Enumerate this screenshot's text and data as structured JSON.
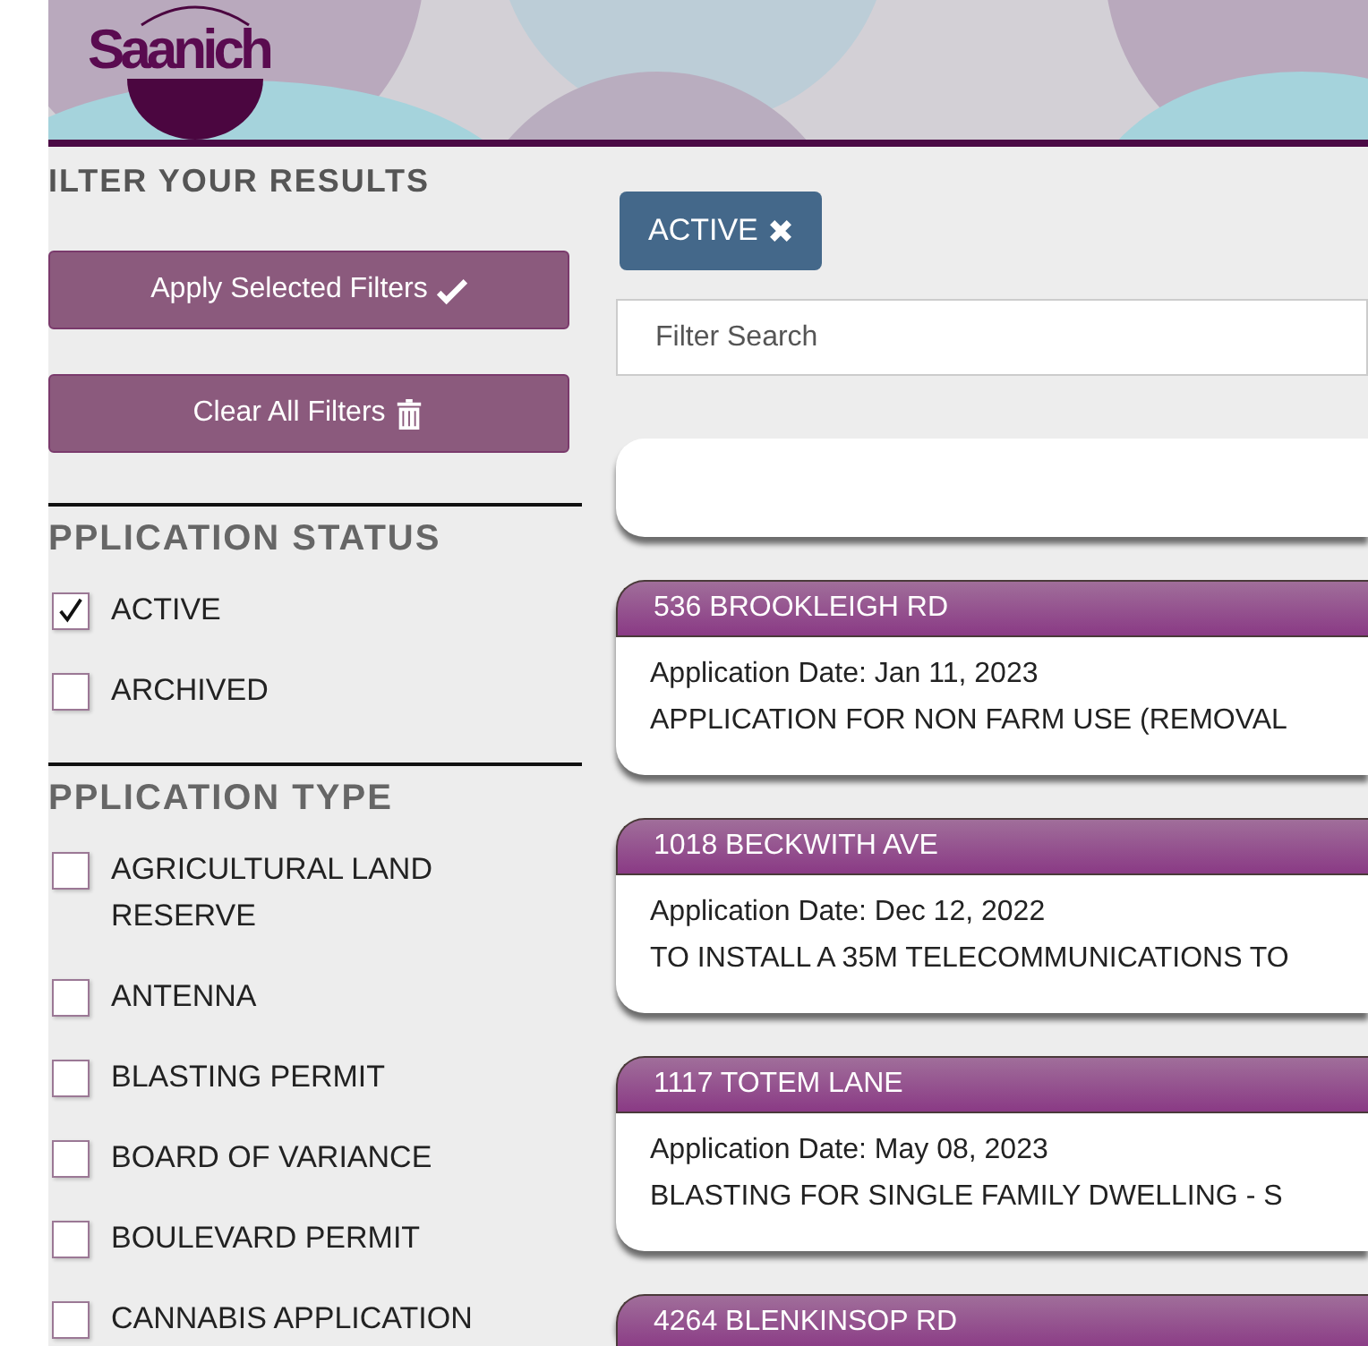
{
  "header": {
    "logo": "Saanich"
  },
  "sidebar": {
    "title": "ILTER YOUR RESULTS",
    "buttons": [
      {
        "label": "Apply Selected Filters",
        "kind": "apply"
      },
      {
        "label": "Clear All Filters",
        "kind": "clear"
      }
    ],
    "groups": [
      {
        "title": "PPLICATION STATUS",
        "options": [
          {
            "label": "ACTIVE",
            "checked": true
          },
          {
            "label": "ARCHIVED",
            "checked": false
          }
        ]
      },
      {
        "title": "PPLICATION TYPE",
        "options": [
          {
            "label": "AGRICULTURAL LAND RESERVE",
            "checked": false
          },
          {
            "label": "ANTENNA",
            "checked": false
          },
          {
            "label": "BLASTING PERMIT",
            "checked": false
          },
          {
            "label": "BOARD OF VARIANCE",
            "checked": false
          },
          {
            "label": "BOULEVARD PERMIT",
            "checked": false
          },
          {
            "label": "CANNABIS APPLICATION",
            "checked": false
          }
        ]
      }
    ]
  },
  "main": {
    "active_filters": [
      {
        "label": "ACTIVE"
      }
    ],
    "search": {
      "placeholder": "Filter Search"
    },
    "results": [
      {
        "address": "536 BROOKLEIGH RD",
        "date": "Application Date: Jan 11, 2023",
        "description": "APPLICATION FOR NON FARM USE (REMOVAL"
      },
      {
        "address": "1018 BECKWITH AVE",
        "date": "Application Date: Dec 12, 2022",
        "description": "TO INSTALL A 35M TELECOMMUNICATIONS TO"
      },
      {
        "address": "1117 TOTEM LANE",
        "date": "Application Date: May 08, 2023",
        "description": "BLASTING FOR SINGLE FAMILY DWELLING - S"
      },
      {
        "address": "4264 BLENKINSOP RD"
      }
    ]
  }
}
